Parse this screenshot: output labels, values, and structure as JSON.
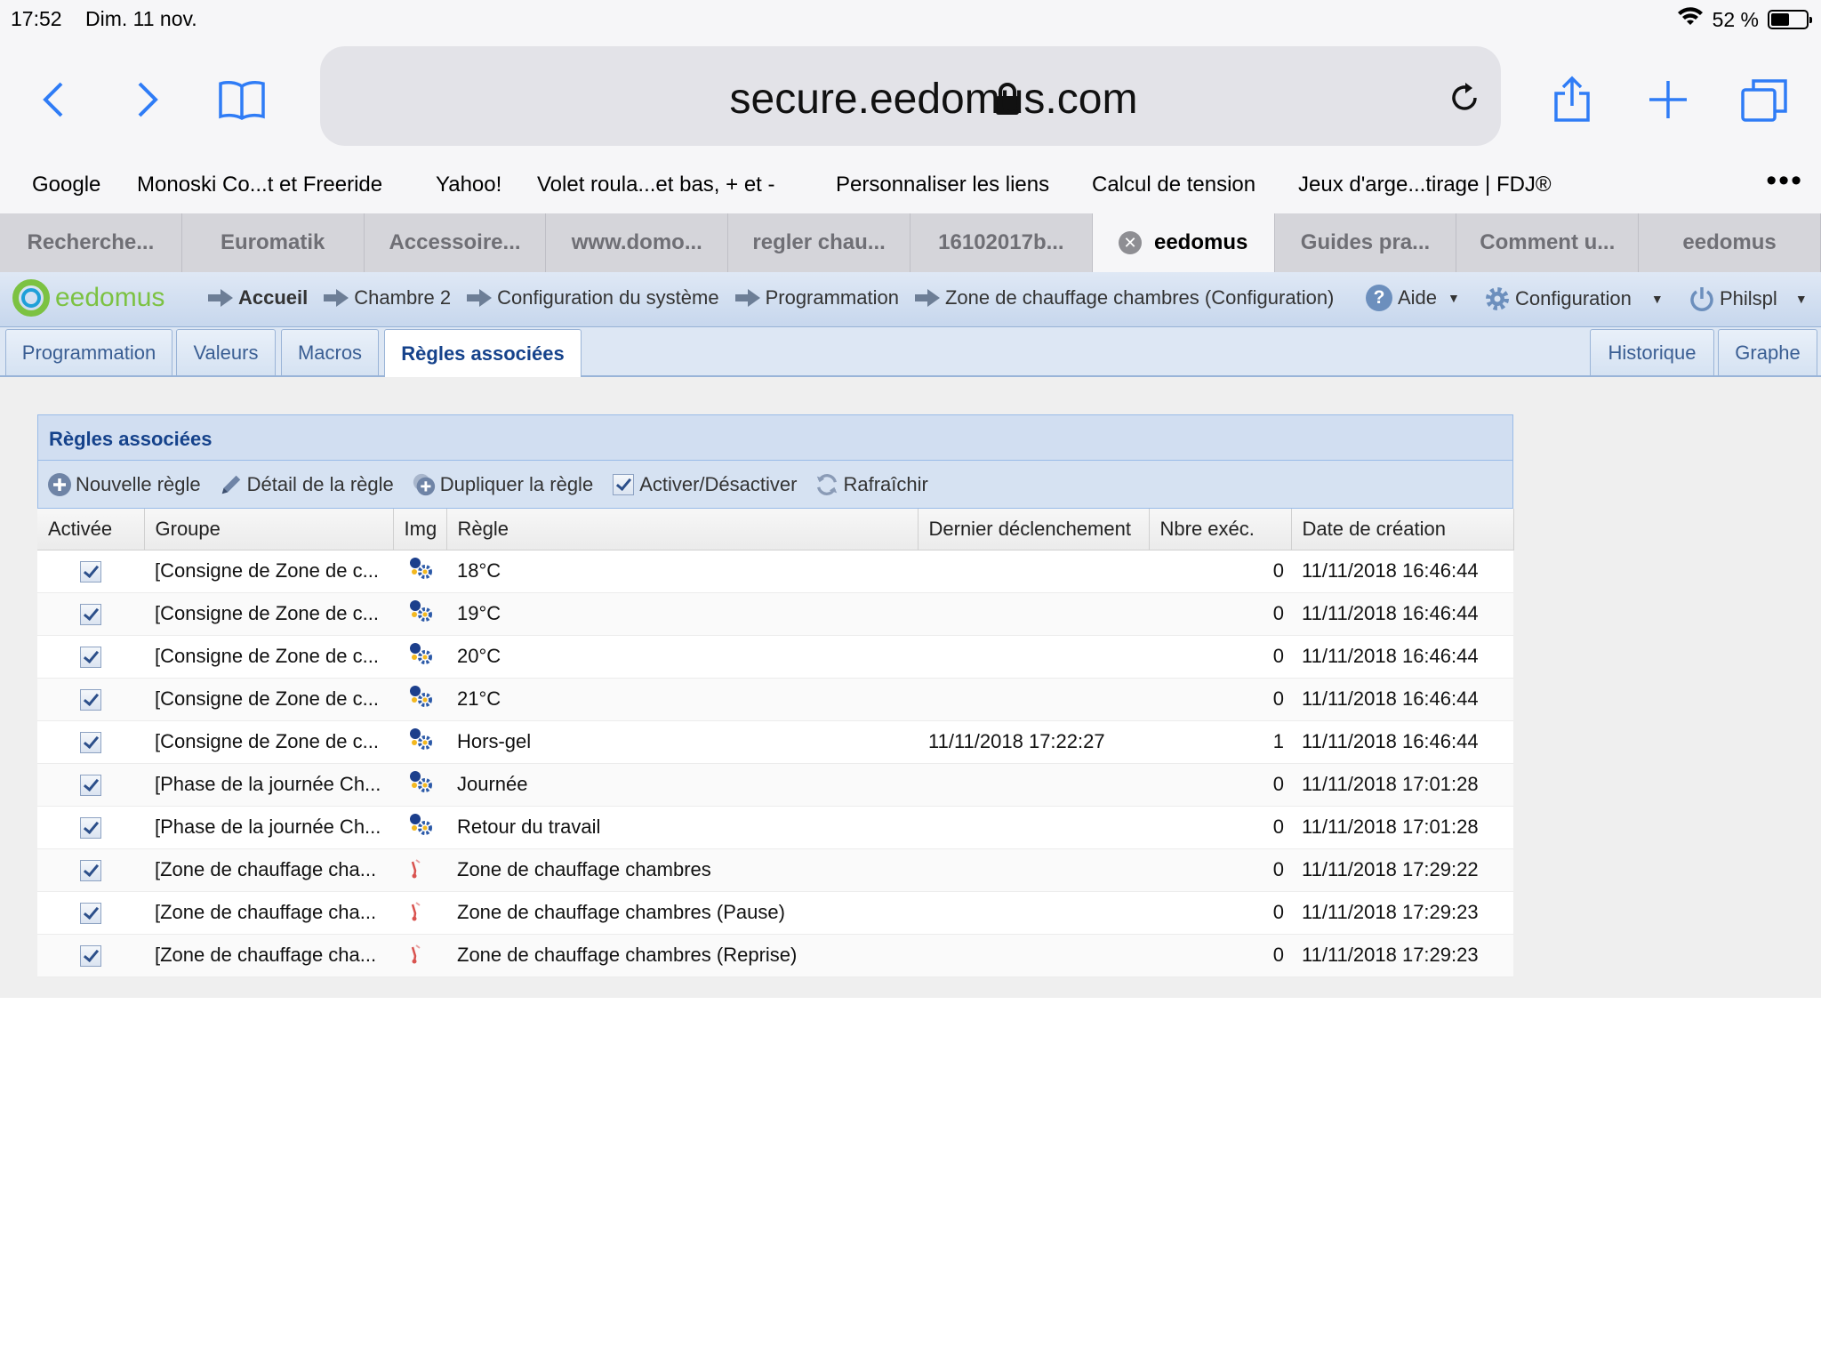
{
  "status": {
    "time": "17:52",
    "date": "Dim. 11 nov.",
    "battery": "52 %"
  },
  "browser": {
    "url": "secure.eedomus.com",
    "bookmarks": [
      "Google",
      "Monoski Co...t et Freeride",
      "Yahoo!",
      "Volet roula...et bas, + et -",
      "Personnaliser les liens",
      "Calcul de tension",
      "Jeux d'arge...tirage | FDJ®"
    ],
    "tabs": [
      "Recherche...",
      "Euromatik",
      "Accessoire...",
      "www.domo...",
      "regler chau...",
      "16102017b...",
      "eedomus",
      "Guides pra...",
      "Comment u...",
      "eedomus"
    ],
    "active_tab_index": 6
  },
  "app": {
    "logo": "eedomus",
    "breadcrumbs": [
      "Accueil",
      "Chambre 2",
      "Configuration du système",
      "Programmation",
      "Zone de chauffage chambres (Configuration)"
    ],
    "menu": {
      "help": "Aide",
      "config": "Configuration",
      "user": "Philspl"
    }
  },
  "subtabs": {
    "left": [
      "Programmation",
      "Valeurs",
      "Macros",
      "Règles associées"
    ],
    "right": [
      "Historique",
      "Graphe"
    ],
    "active": "Règles associées"
  },
  "panel": {
    "title": "Règles associées",
    "tools": {
      "new": "Nouvelle règle",
      "detail": "Détail de la règle",
      "duplicate": "Dupliquer la règle",
      "toggle": "Activer/Désactiver",
      "refresh": "Rafraîchir"
    },
    "columns": [
      "Activée",
      "Groupe",
      "Img",
      "Règle",
      "Dernier déclenchement",
      "Nbre exéc.",
      "Date de création"
    ],
    "rows": [
      {
        "group": "[Consigne de Zone de c...",
        "icon": "gear-rule",
        "rule": "18°C",
        "last": "",
        "count": "0",
        "created": "11/11/2018 16:46:44"
      },
      {
        "group": "[Consigne de Zone de c...",
        "icon": "gear-rule",
        "rule": "19°C",
        "last": "",
        "count": "0",
        "created": "11/11/2018 16:46:44"
      },
      {
        "group": "[Consigne de Zone de c...",
        "icon": "gear-rule",
        "rule": "20°C",
        "last": "",
        "count": "0",
        "created": "11/11/2018 16:46:44"
      },
      {
        "group": "[Consigne de Zone de c...",
        "icon": "gear-rule",
        "rule": "21°C",
        "last": "",
        "count": "0",
        "created": "11/11/2018 16:46:44"
      },
      {
        "group": "[Consigne de Zone de c...",
        "icon": "gear-rule",
        "rule": "Hors-gel",
        "last": "11/11/2018 17:22:27",
        "count": "1",
        "created": "11/11/2018 16:46:44"
      },
      {
        "group": "[Phase de la journée Ch...",
        "icon": "gear-rule",
        "rule": "Journée",
        "last": "",
        "count": "0",
        "created": "11/11/2018 17:01:28"
      },
      {
        "group": "[Phase de la journée Ch...",
        "icon": "gear-rule",
        "rule": "Retour du travail",
        "last": "",
        "count": "0",
        "created": "11/11/2018 17:01:28"
      },
      {
        "group": "[Zone de chauffage cha...",
        "icon": "thermometer",
        "rule": "Zone de chauffage chambres",
        "last": "",
        "count": "0",
        "created": "11/11/2018 17:29:22"
      },
      {
        "group": "[Zone de chauffage cha...",
        "icon": "thermometer",
        "rule": "Zone de chauffage chambres (Pause)",
        "last": "",
        "count": "0",
        "created": "11/11/2018 17:29:23"
      },
      {
        "group": "[Zone de chauffage cha...",
        "icon": "thermometer",
        "rule": "Zone de chauffage chambres (Reprise)",
        "last": "",
        "count": "0",
        "created": "11/11/2018 17:29:23"
      }
    ]
  }
}
